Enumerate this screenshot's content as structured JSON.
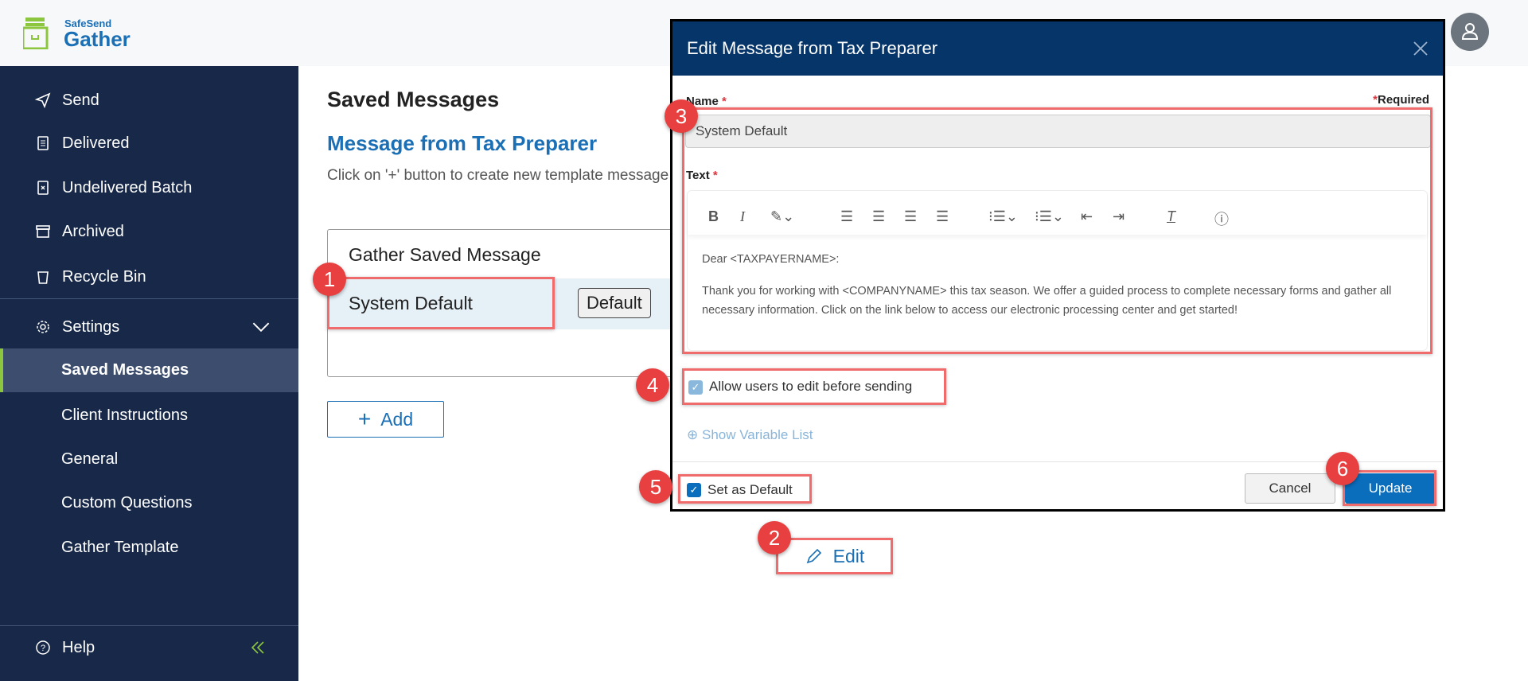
{
  "app": {
    "brand_top": "SafeSend",
    "brand_name": "Gather"
  },
  "sidebar": {
    "items": [
      {
        "label": "Send",
        "icon": "send-icon"
      },
      {
        "label": "Delivered",
        "icon": "document-icon"
      },
      {
        "label": "Undelivered Batch",
        "icon": "x-document-icon"
      },
      {
        "label": "Archived",
        "icon": "archive-icon"
      },
      {
        "label": "Recycle Bin",
        "icon": "trash-icon"
      }
    ],
    "settings": {
      "label": "Settings",
      "expanded": true,
      "children": [
        "Saved Messages",
        "Client Instructions",
        "General",
        "Custom Questions",
        "Gather Template"
      ],
      "active": "Saved Messages"
    },
    "help": "Help"
  },
  "main": {
    "title": "Saved Messages",
    "section_title": "Message from Tax Preparer",
    "hint": "Click on '+' button to create new template messages",
    "list_header": "Gather Saved Message",
    "rows": [
      {
        "name": "System Default",
        "badge": "Default"
      }
    ],
    "add_label": "Add",
    "edit_label": "Edit"
  },
  "modal": {
    "title": "Edit Message from Tax Preparer",
    "name_label": "Name",
    "required_note": "Required",
    "name_value": "System Default",
    "text_label": "Text",
    "body_lines": [
      "Dear <TAXPAYERNAME>:",
      "Thank you for working with <COMPANYNAME> this tax season. We offer a guided process to complete necessary forms and gather all necessary information.  Click on the link below to access our electronic processing center and get started!"
    ],
    "allow_edit_label": "Allow users to edit before sending",
    "allow_edit_checked": true,
    "variable_list_label": "Show Variable List",
    "set_default_label": "Set as Default",
    "set_default_checked": true,
    "cancel_label": "Cancel",
    "update_label": "Update"
  },
  "annotations": [
    "1",
    "2",
    "3",
    "4",
    "5",
    "6"
  ],
  "colors": {
    "sidebar": "#172848",
    "accent": "#1a6fb5",
    "modal_header": "#06356a",
    "annotation": "#e84040",
    "active_marker": "#8cc63f"
  }
}
